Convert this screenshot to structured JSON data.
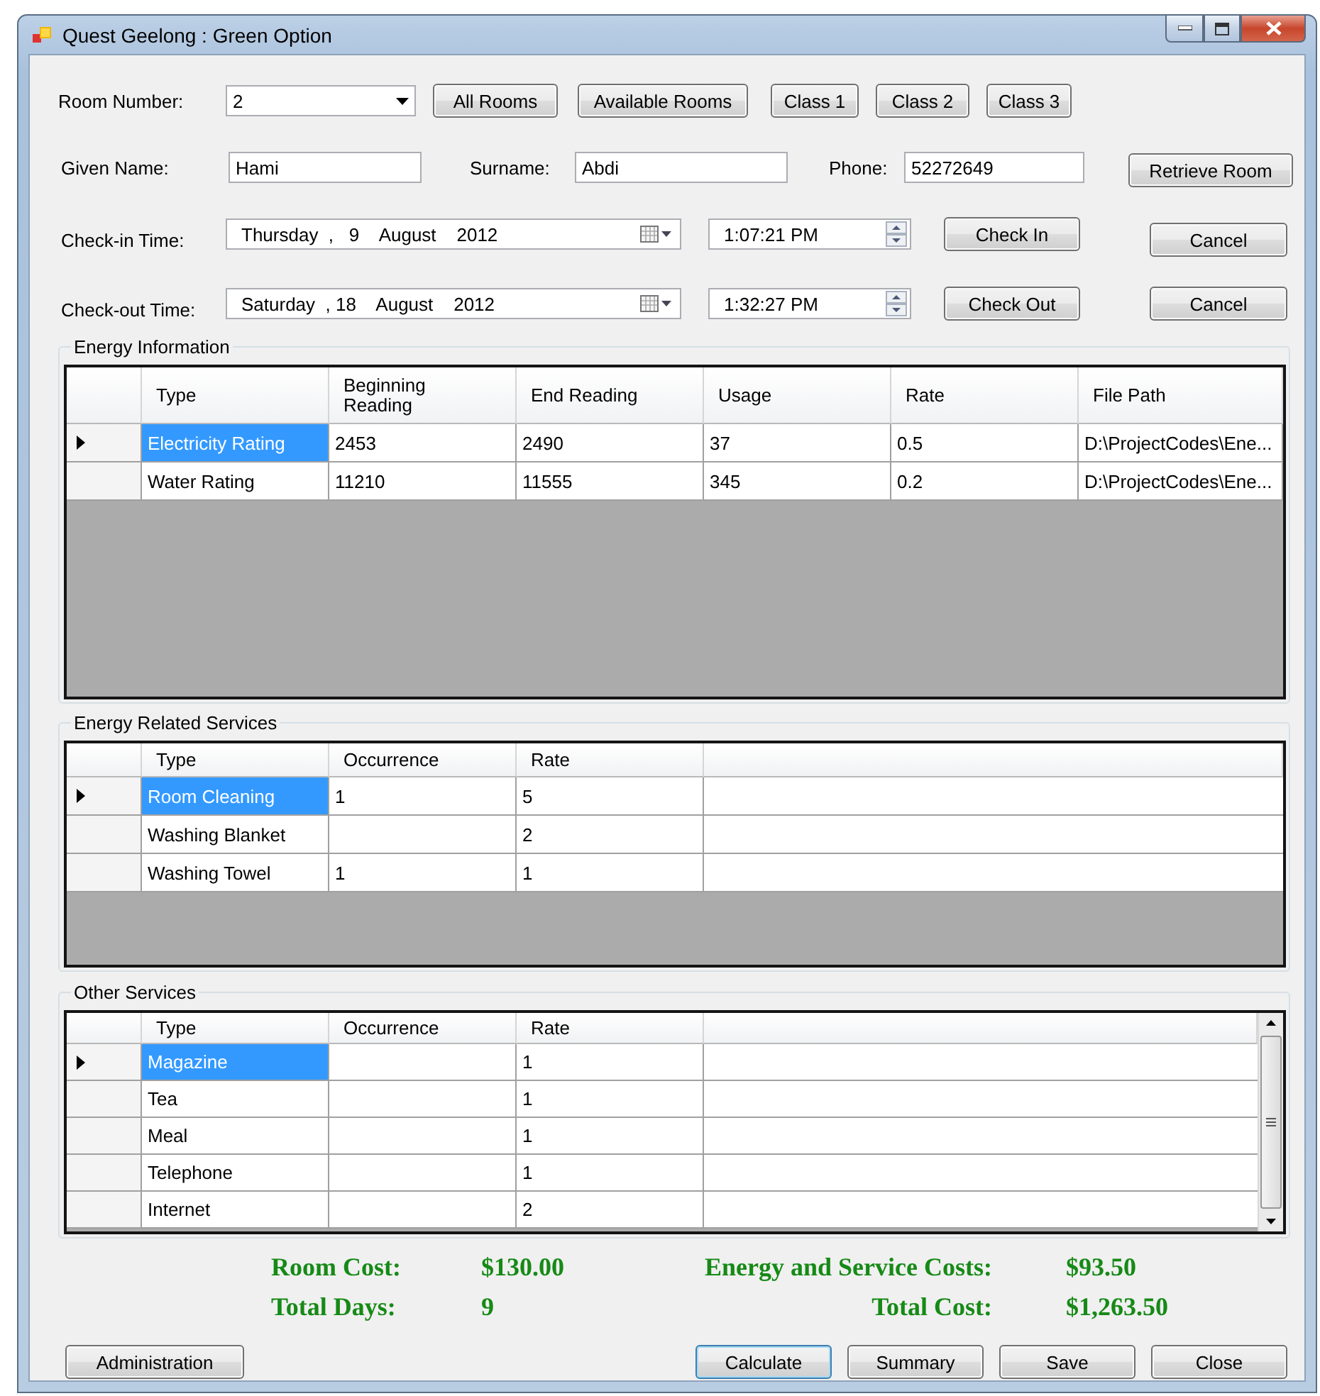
{
  "window": {
    "title": "Quest Geelong : Green Option"
  },
  "room": {
    "label": "Room Number:",
    "value": "2",
    "buttons": [
      "All Rooms",
      "Available Rooms",
      "Class 1",
      "Class 2",
      "Class 3"
    ]
  },
  "guest": {
    "fields": [
      {
        "label": "Given Name:",
        "value": "Hami"
      },
      {
        "label": "Surname:",
        "value": "Abdi"
      },
      {
        "label": "Phone:",
        "value": "52272649"
      }
    ],
    "button": "Retrieve Room"
  },
  "times": [
    {
      "label": "Check-in Time:",
      "date": "Thursday  ,   9    August    2012",
      "time": "1:07:21 PM",
      "action": "Check In",
      "cancel": "Cancel"
    },
    {
      "label": "Check-out Time:",
      "date": "Saturday  , 18    August    2012",
      "time": "1:32:27 PM",
      "action": "Check Out",
      "cancel": "Cancel"
    }
  ],
  "grids": [
    {
      "title": "Energy Information",
      "kind": "readings",
      "columns": [
        "Type",
        "Beginning Reading",
        "End Reading",
        "Usage",
        "Rate",
        "File Path"
      ],
      "rows": [
        {
          "selected": true,
          "cells": [
            "Electricity Rating",
            "2453",
            "2490",
            "37",
            "0.5",
            "D:\\ProjectCodes\\Ene..."
          ]
        },
        {
          "selected": false,
          "cells": [
            "Water Rating",
            "11210",
            "11555",
            "345",
            "0.2",
            "D:\\ProjectCodes\\Ene..."
          ]
        }
      ]
    },
    {
      "title": "Energy Related Services",
      "kind": "services",
      "columns": [
        "Type",
        "Occurrence",
        "Rate"
      ],
      "rows": [
        {
          "selected": true,
          "cells": [
            "Room Cleaning",
            "1",
            "5"
          ]
        },
        {
          "selected": false,
          "cells": [
            "Washing Blanket",
            "",
            "2"
          ]
        },
        {
          "selected": false,
          "cells": [
            "Washing Towel",
            "1",
            "1"
          ]
        }
      ]
    },
    {
      "title": "Other Services",
      "kind": "services",
      "scrollable": true,
      "columns": [
        "Type",
        "Occurrence",
        "Rate"
      ],
      "rows": [
        {
          "selected": true,
          "cells": [
            "Magazine",
            "",
            "1"
          ]
        },
        {
          "selected": false,
          "cells": [
            "Tea",
            "",
            "1"
          ]
        },
        {
          "selected": false,
          "cells": [
            "Meal",
            "",
            "1"
          ]
        },
        {
          "selected": false,
          "cells": [
            "Telephone",
            "",
            "1"
          ]
        },
        {
          "selected": false,
          "cells": [
            "Internet",
            "",
            "2"
          ]
        }
      ]
    }
  ],
  "totals": [
    {
      "label": "Room Cost:",
      "value": "$130.00"
    },
    {
      "label": "Energy and Service Costs:",
      "value": "$93.50"
    },
    {
      "label": "Total Days:",
      "value": "9"
    },
    {
      "label": "Total Cost:",
      "value": "$1,263.50"
    }
  ],
  "buttons": [
    {
      "label": "Administration",
      "focused": false
    },
    {
      "label": "Calculate",
      "focused": true
    },
    {
      "label": "Summary",
      "focused": false
    },
    {
      "label": "Save",
      "focused": false
    },
    {
      "label": "Close",
      "focused": false
    }
  ]
}
